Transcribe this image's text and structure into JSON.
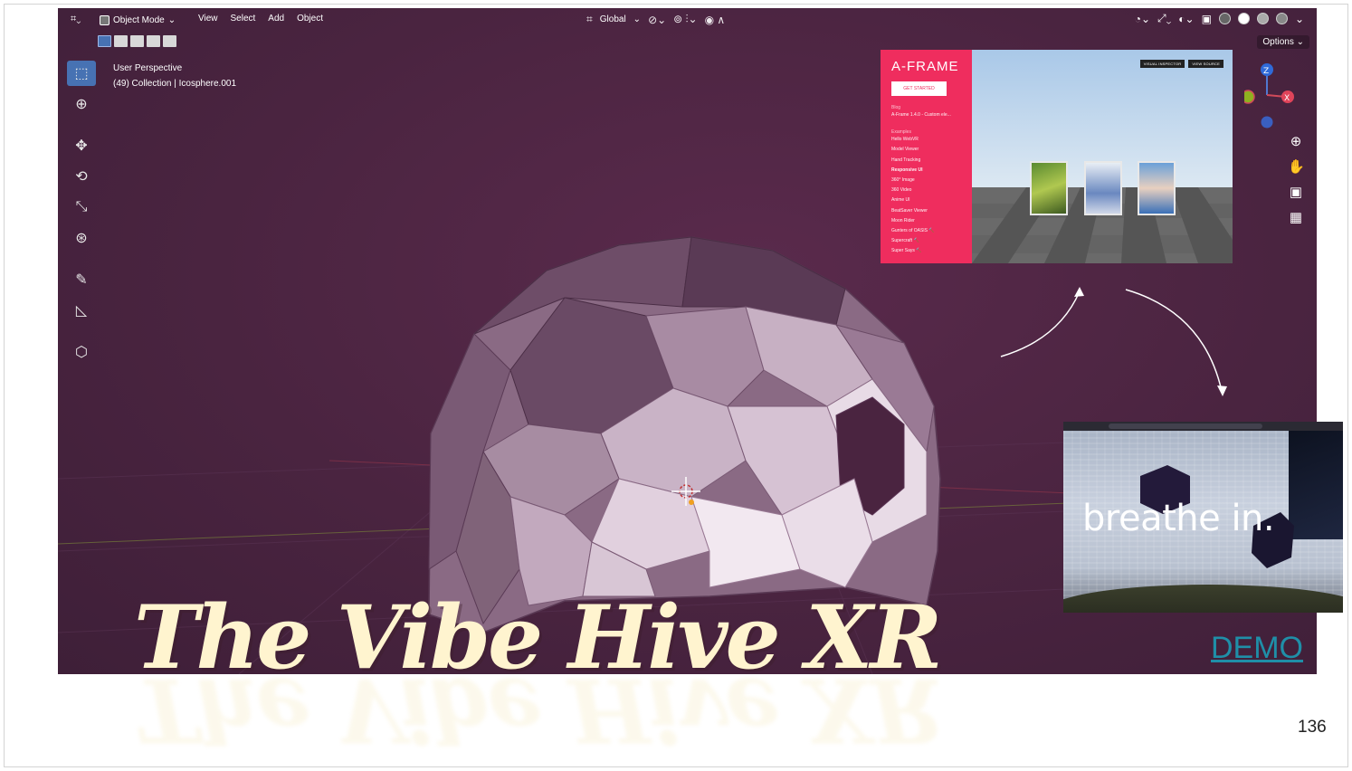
{
  "slide": {
    "title": "The Vibe Hive XR",
    "demo_link": "DEMO",
    "page_number": "136"
  },
  "blender": {
    "header": {
      "mode": "Object Mode",
      "menus": [
        "View",
        "Select",
        "Add",
        "Object"
      ],
      "transform_orientation": "Global",
      "options": "Options"
    },
    "viewport_info": {
      "view": "User Perspective",
      "collection": "(49) Collection | Icosphere.001"
    },
    "toolbar_icons": [
      "select-box-icon",
      "cursor-icon",
      "move-icon",
      "rotate-icon",
      "scale-icon",
      "transform-icon",
      "annotate-icon",
      "measure-icon",
      "add-cube-icon"
    ],
    "gizmo": {
      "z_label": "Z",
      "x_label": "X"
    },
    "colors": {
      "viewport_bg": "#4a2440",
      "active_tool": "#4772b3"
    }
  },
  "aframe_inset": {
    "logo": "A-FRAME",
    "get_started": "GET STARTED",
    "blog_heading": "Blog",
    "blog_post": "A-Frame 1.4.0 - Custom ele...",
    "examples_heading": "Examples",
    "examples": [
      "Hello WebVR",
      "Model Viewer",
      "Hand Tracking",
      "Responsive UI",
      "360° Image",
      "360 Video",
      "Anime UI",
      "BeatSaver Viewer",
      "Moon Rider",
      "Gunters of OASIS 🔨",
      "Supercraft 🔨",
      "Super Says 🔨"
    ],
    "visual_inspector": "VISUAL INSPECTOR",
    "view_source": "VIEW SOURCE",
    "accent": "#ef2d5e"
  },
  "breathe_inset": {
    "text": "breathe in."
  }
}
